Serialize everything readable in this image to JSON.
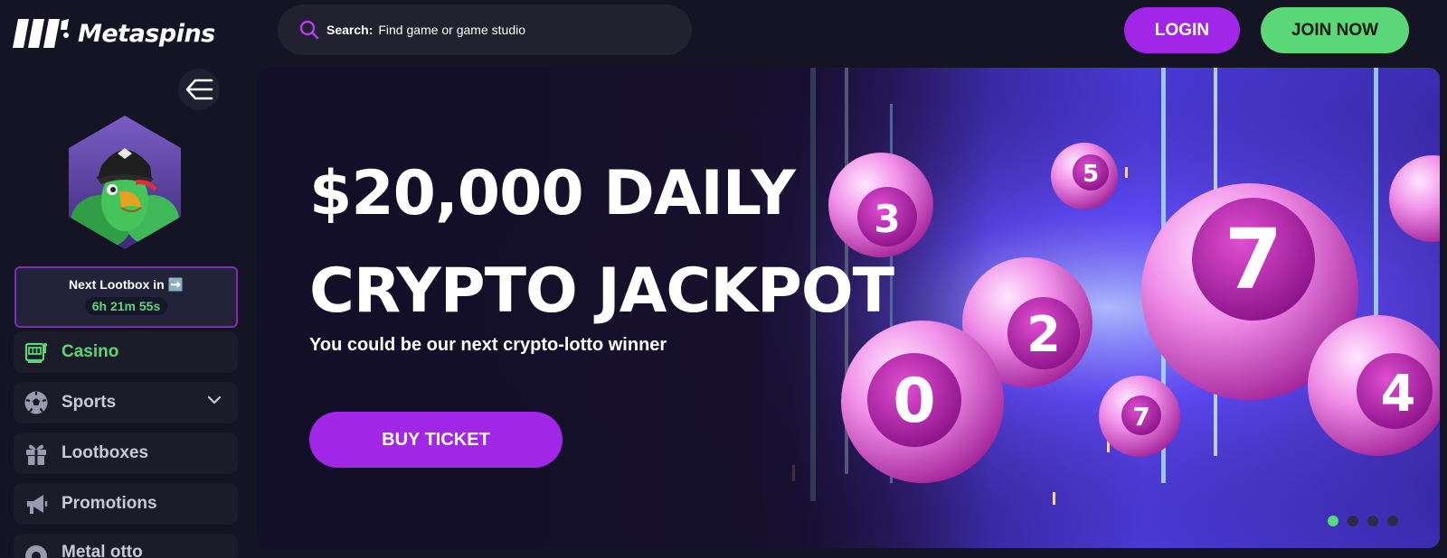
{
  "header": {
    "brand": "Metaspins",
    "search": {
      "label": "Search:",
      "placeholder": "Find game or game studio"
    },
    "login_label": "LOGIN",
    "join_label": "JOIN NOW"
  },
  "sidebar": {
    "lootbox": {
      "title": "Next Lootbox in ➡️",
      "timer": "6h 21m 55s"
    },
    "items": [
      {
        "label": "Casino",
        "icon": "slot-machine-icon",
        "active": true
      },
      {
        "label": "Sports",
        "icon": "soccer-ball-icon",
        "has_submenu": true
      },
      {
        "label": "Lootboxes",
        "icon": "gift-icon"
      },
      {
        "label": "Promotions",
        "icon": "megaphone-icon"
      },
      {
        "label": "Metal otto",
        "icon": "lotto-icon"
      }
    ]
  },
  "banner": {
    "title_line1": "$20,000 DAILY",
    "title_line2": "CRYPTO JACKPOT",
    "subtitle": "You could be our next crypto-lotto winner",
    "cta_label": "BUY TICKET",
    "balls": [
      "3",
      "5",
      "7",
      "2",
      "0",
      "7",
      "4"
    ],
    "slides_total": 4,
    "slide_active": 1
  },
  "colors": {
    "background": "#141424",
    "accent_purple": "#a226e7",
    "accent_green": "#5ad776"
  }
}
